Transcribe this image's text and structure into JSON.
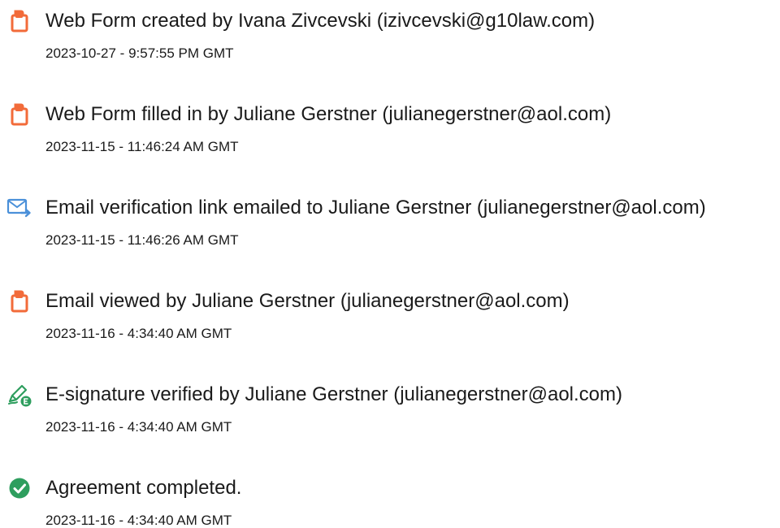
{
  "events": [
    {
      "icon": "document-icon",
      "text": "Web Form created by Ivana Zivcevski (izivcevski@g10law.com)",
      "timestamp": "2023-10-27 - 9:57:55 PM GMT"
    },
    {
      "icon": "document-icon",
      "text": "Web Form filled in by Juliane Gerstner (julianegerstner@aol.com)",
      "timestamp": "2023-11-15 - 11:46:24 AM GMT"
    },
    {
      "icon": "email-forward-icon",
      "text": "Email verification link emailed to Juliane Gerstner (julianegerstner@aol.com)",
      "timestamp": "2023-11-15 - 11:46:26 AM GMT"
    },
    {
      "icon": "document-icon",
      "text": "Email viewed by Juliane Gerstner (julianegerstner@aol.com)",
      "timestamp": "2023-11-16 - 4:34:40 AM GMT"
    },
    {
      "icon": "pen-verified-icon",
      "text": "E-signature verified by Juliane Gerstner (julianegerstner@aol.com)",
      "timestamp": "2023-11-16 - 4:34:40 AM GMT"
    },
    {
      "icon": "check-circle-icon",
      "text": "Agreement completed.",
      "timestamp": "2023-11-16 - 4:34:40 AM GMT"
    }
  ],
  "colors": {
    "document_icon": "#f26b3a",
    "email_icon": "#4a90d9",
    "pen_icon": "#2e9e5e",
    "check_icon": "#2e9e5e"
  }
}
